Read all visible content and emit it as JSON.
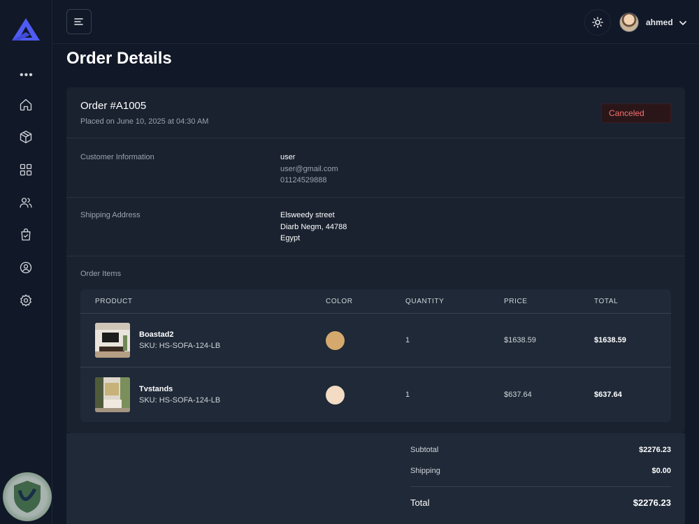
{
  "header": {
    "user_name": "ahmed"
  },
  "page": {
    "title": "Order Details"
  },
  "order": {
    "number": "Order #A1005",
    "placed_on": "Placed on June 10, 2025 at 04:30 AM",
    "status": "Canceled",
    "status_color": "#f87171"
  },
  "customer": {
    "label": "Customer Information",
    "name": "user",
    "email": "user@gmail.com",
    "phone": "01124529888"
  },
  "shipping": {
    "label": "Shipping Address",
    "line1": "Elsweedy street",
    "line2": "Diarb Negm, 44788",
    "line3": "Egypt"
  },
  "items": {
    "label": "Order Items",
    "columns": [
      "PRODUCT",
      "COLOR",
      "QUANTITY",
      "PRICE",
      "TOTAL"
    ],
    "rows": [
      {
        "name": "Boastad2",
        "sku": "SKU: HS-SOFA-124-LB",
        "color": "#d5a96d",
        "quantity": "1",
        "price": "$1638.59",
        "total": "$1638.59"
      },
      {
        "name": "Tvstands",
        "sku": "SKU: HS-SOFA-124-LB",
        "color": "#f3dbc4",
        "quantity": "1",
        "price": "$637.64",
        "total": "$637.64"
      }
    ]
  },
  "summary": {
    "subtotal_label": "Subtotal",
    "subtotal": "$2276.23",
    "shipping_label": "Shipping",
    "shipping": "$0.00",
    "total_label": "Total",
    "total": "$2276.23"
  },
  "colors": {
    "accent": "#4f5bf2",
    "background": "#111827",
    "card": "#1a2230"
  },
  "icons": {
    "sidebar": [
      "more-dots-icon",
      "home-icon",
      "box-icon",
      "grid-icon",
      "users-icon",
      "shopping-bag-icon",
      "user-circle-icon",
      "gear-icon"
    ],
    "header": [
      "menu-icon",
      "sun-icon",
      "chevron-down-icon"
    ]
  }
}
